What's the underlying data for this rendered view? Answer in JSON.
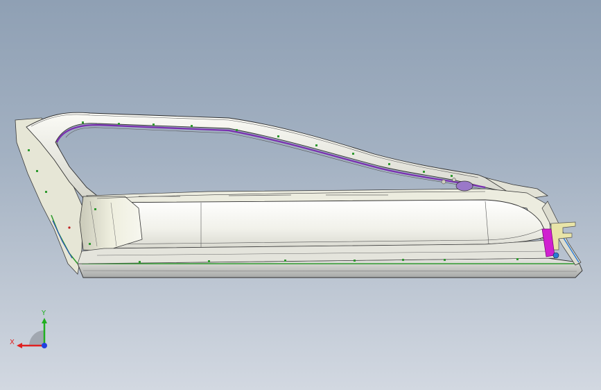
{
  "viewport": {
    "model": "door-frame-3d-model",
    "colors": {
      "background_top": "#8fa0b4",
      "background_bottom": "#d2d8e1",
      "model_surface": "#f4f4ee",
      "edge_lines": "#3a3a3a",
      "trim_purple": "#7a2fb0",
      "clip_green": "#2f9a2f",
      "hinge_yellow": "#e8e4a8",
      "hinge_magenta": "#d020d0",
      "accent_blue": "#2a7ad6"
    }
  },
  "triad": {
    "x_label": "X",
    "y_label": "Y",
    "x_color": "#e02020",
    "y_color": "#20b020",
    "z_color": "#2040e0"
  }
}
